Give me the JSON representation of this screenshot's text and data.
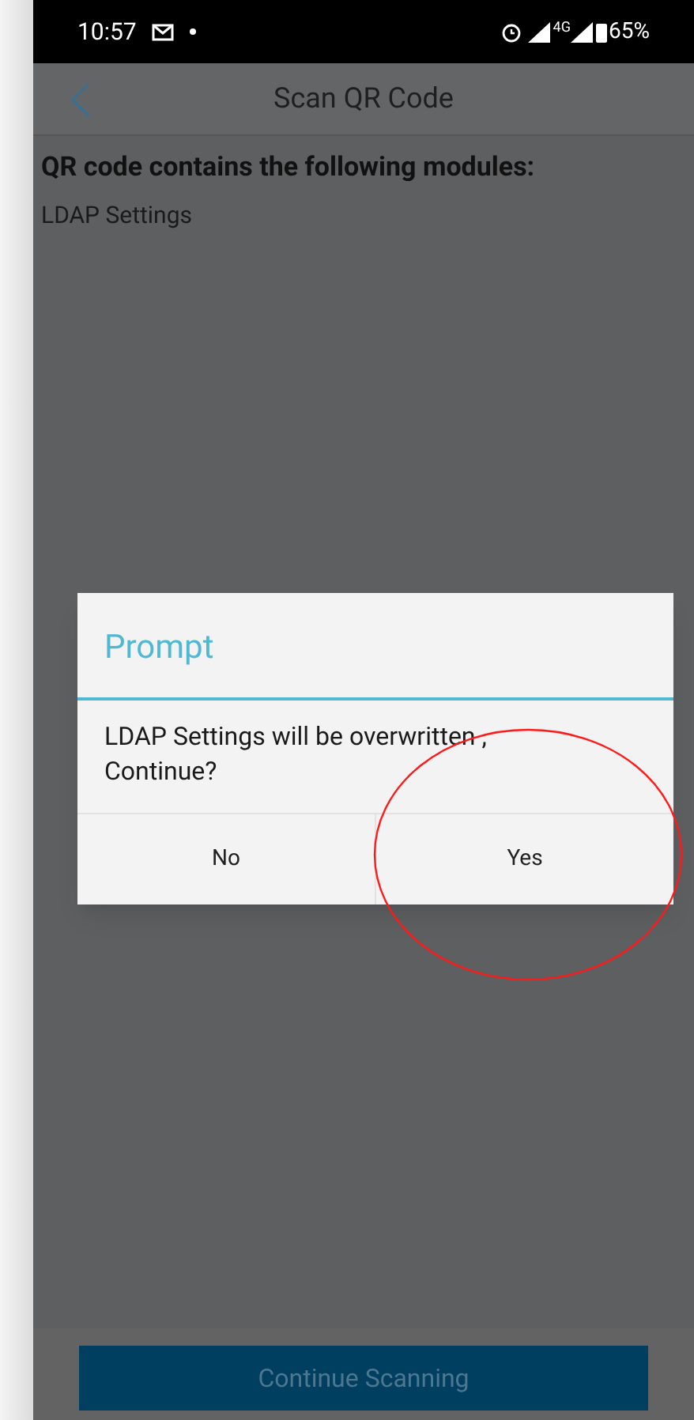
{
  "status_bar": {
    "time": "10:57",
    "network": "4G",
    "battery": "65%"
  },
  "header": {
    "title": "Scan QR Code"
  },
  "content": {
    "heading": "QR code contains the following modules:",
    "modules": [
      "LDAP Settings"
    ]
  },
  "dialog": {
    "title": "Prompt",
    "message": "LDAP Settings will be overwritten ,\nContinue?",
    "buttons": [
      {
        "label": "No",
        "highlighted": false
      },
      {
        "label": "Yes",
        "highlighted": true
      }
    ]
  },
  "footer": {
    "button": "Continue Scanning"
  }
}
